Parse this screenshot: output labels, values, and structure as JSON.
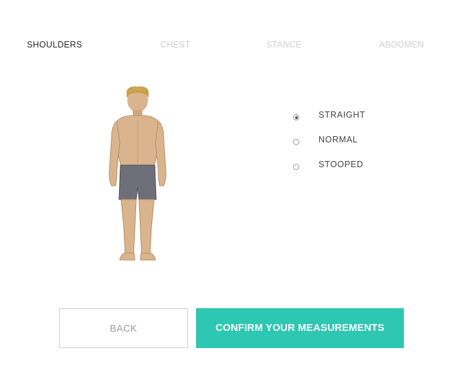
{
  "tabs": [
    {
      "label": "SHOULDERS",
      "active": true
    },
    {
      "label": "CHEST",
      "active": false
    },
    {
      "label": "STANCE",
      "active": false
    },
    {
      "label": "ABDOMEN",
      "active": false
    }
  ],
  "options": [
    {
      "label": "STRAIGHT",
      "selected": true
    },
    {
      "label": "NORMAL",
      "selected": false
    },
    {
      "label": "STOOPED",
      "selected": false
    }
  ],
  "buttons": {
    "back_label": "BACK",
    "confirm_label": "CONFIRM YOUR MEASUREMENTS"
  },
  "colors": {
    "accent": "#2ec7b1",
    "skin": "#d9b48c",
    "hair": "#c9a24a",
    "shorts": "#6e6e78"
  }
}
